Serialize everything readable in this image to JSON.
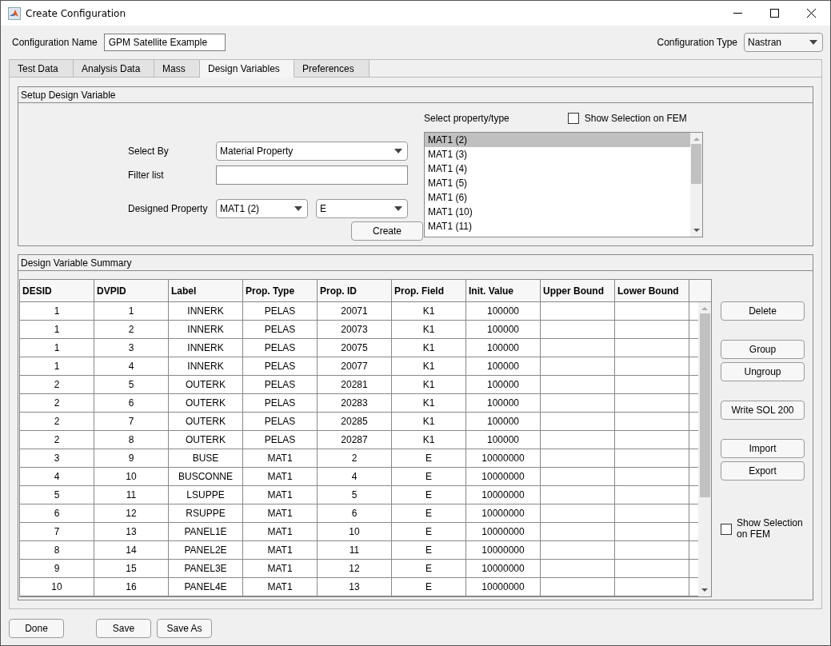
{
  "window": {
    "title": "Create Configuration"
  },
  "config_name": {
    "label": "Configuration Name",
    "value": "GPM Satellite Example"
  },
  "config_type": {
    "label": "Configuration Type",
    "value": "Nastran"
  },
  "tabs": [
    {
      "label": "Test Data",
      "selected": false
    },
    {
      "label": "Analysis Data",
      "selected": false
    },
    {
      "label": "Mass",
      "selected": false
    },
    {
      "label": "Design Variables",
      "selected": true
    },
    {
      "label": "Preferences",
      "selected": false
    }
  ],
  "setup": {
    "title": "Setup Design Variable",
    "select_by": {
      "label": "Select By",
      "value": "Material Property"
    },
    "filter": {
      "label": "Filter list"
    },
    "designed_property": {
      "label": "Designed Property",
      "value": "MAT1 (2)",
      "field": "E"
    },
    "create_button": "Create",
    "list_label": "Select property/type",
    "show_selection": {
      "label": "Show Selection on FEM",
      "checked": false
    },
    "list": [
      {
        "text": "MAT1 (2)",
        "selected": true
      },
      {
        "text": "MAT1 (3)",
        "selected": false
      },
      {
        "text": "MAT1 (4)",
        "selected": false
      },
      {
        "text": "MAT1 (5)",
        "selected": false
      },
      {
        "text": "MAT1 (6)",
        "selected": false
      },
      {
        "text": "MAT1 (10)",
        "selected": false
      },
      {
        "text": "MAT1 (11)",
        "selected": false
      }
    ]
  },
  "summary": {
    "title": "Design Variable Summary",
    "columns": [
      "DESID",
      "DVPID",
      "Label",
      "Prop. Type",
      "Prop. ID",
      "Prop. Field",
      "Init. Value",
      "Upper Bound",
      "Lower Bound"
    ],
    "rows": [
      [
        "1",
        "1",
        "INNERK",
        "PELAS",
        "20071",
        "K1",
        "100000"
      ],
      [
        "1",
        "2",
        "INNERK",
        "PELAS",
        "20073",
        "K1",
        "100000"
      ],
      [
        "1",
        "3",
        "INNERK",
        "PELAS",
        "20075",
        "K1",
        "100000"
      ],
      [
        "1",
        "4",
        "INNERK",
        "PELAS",
        "20077",
        "K1",
        "100000"
      ],
      [
        "2",
        "5",
        "OUTERK",
        "PELAS",
        "20281",
        "K1",
        "100000"
      ],
      [
        "2",
        "6",
        "OUTERK",
        "PELAS",
        "20283",
        "K1",
        "100000"
      ],
      [
        "2",
        "7",
        "OUTERK",
        "PELAS",
        "20285",
        "K1",
        "100000"
      ],
      [
        "2",
        "8",
        "OUTERK",
        "PELAS",
        "20287",
        "K1",
        "100000"
      ],
      [
        "3",
        "9",
        "BUSE",
        "MAT1",
        "2",
        "E",
        "10000000"
      ],
      [
        "4",
        "10",
        "BUSCONNE",
        "MAT1",
        "4",
        "E",
        "10000000"
      ],
      [
        "5",
        "11",
        "LSUPPE",
        "MAT1",
        "5",
        "E",
        "10000000"
      ],
      [
        "6",
        "12",
        "RSUPPE",
        "MAT1",
        "6",
        "E",
        "10000000"
      ],
      [
        "7",
        "13",
        "PANEL1E",
        "MAT1",
        "10",
        "E",
        "10000000"
      ],
      [
        "8",
        "14",
        "PANEL2E",
        "MAT1",
        "11",
        "E",
        "10000000"
      ],
      [
        "9",
        "15",
        "PANEL3E",
        "MAT1",
        "12",
        "E",
        "10000000"
      ],
      [
        "10",
        "16",
        "PANEL4E",
        "MAT1",
        "13",
        "E",
        "10000000"
      ]
    ],
    "button_groups": [
      [
        "Delete"
      ],
      [
        "Group",
        "Ungroup"
      ],
      [
        "Write SOL 200"
      ],
      [
        "Import",
        "Export"
      ]
    ],
    "show_selection": {
      "label": "Show Selection on FEM",
      "checked": false
    }
  },
  "footer_button_groups": [
    [
      "Done"
    ],
    [
      "Save",
      "Save As"
    ]
  ]
}
